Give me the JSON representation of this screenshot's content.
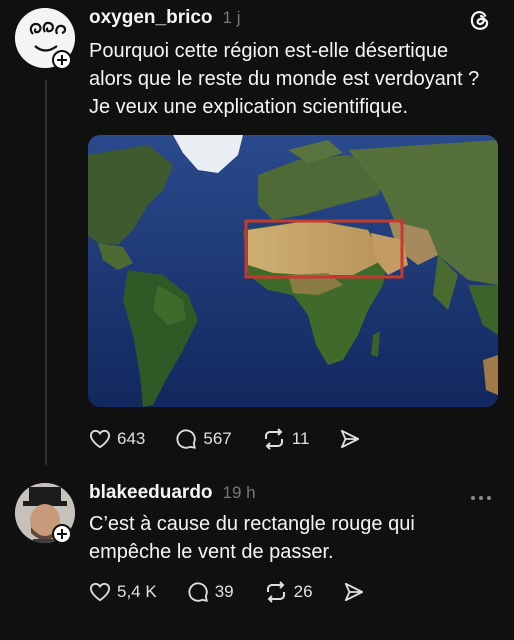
{
  "post1": {
    "username": "oxygen_brico",
    "time": "1 j",
    "text_lines": [
      "Pourquoi cette région est-elle désertique",
      "alors que le reste du monde est verdoyant ?",
      "Je veux une explication scientifique."
    ],
    "likes": "643",
    "comments": "567",
    "reposts": "11"
  },
  "post2": {
    "username": "blakeeduardo",
    "time": "19 h",
    "text_lines": [
      "C’est à cause du rectangle rouge qui",
      "empêche le vent de passer."
    ],
    "likes": "5,4 K",
    "comments": "39",
    "reposts": "26"
  },
  "colors": {
    "background": "#101010",
    "highlight_box": "#c8382e",
    "ocean": "#1f3d7a",
    "desert": "#c9a86a"
  },
  "icons": [
    "threads-logo-icon",
    "heart-icon",
    "comment-icon",
    "repost-icon",
    "share-icon",
    "more-icon",
    "follow-plus-icon"
  ]
}
